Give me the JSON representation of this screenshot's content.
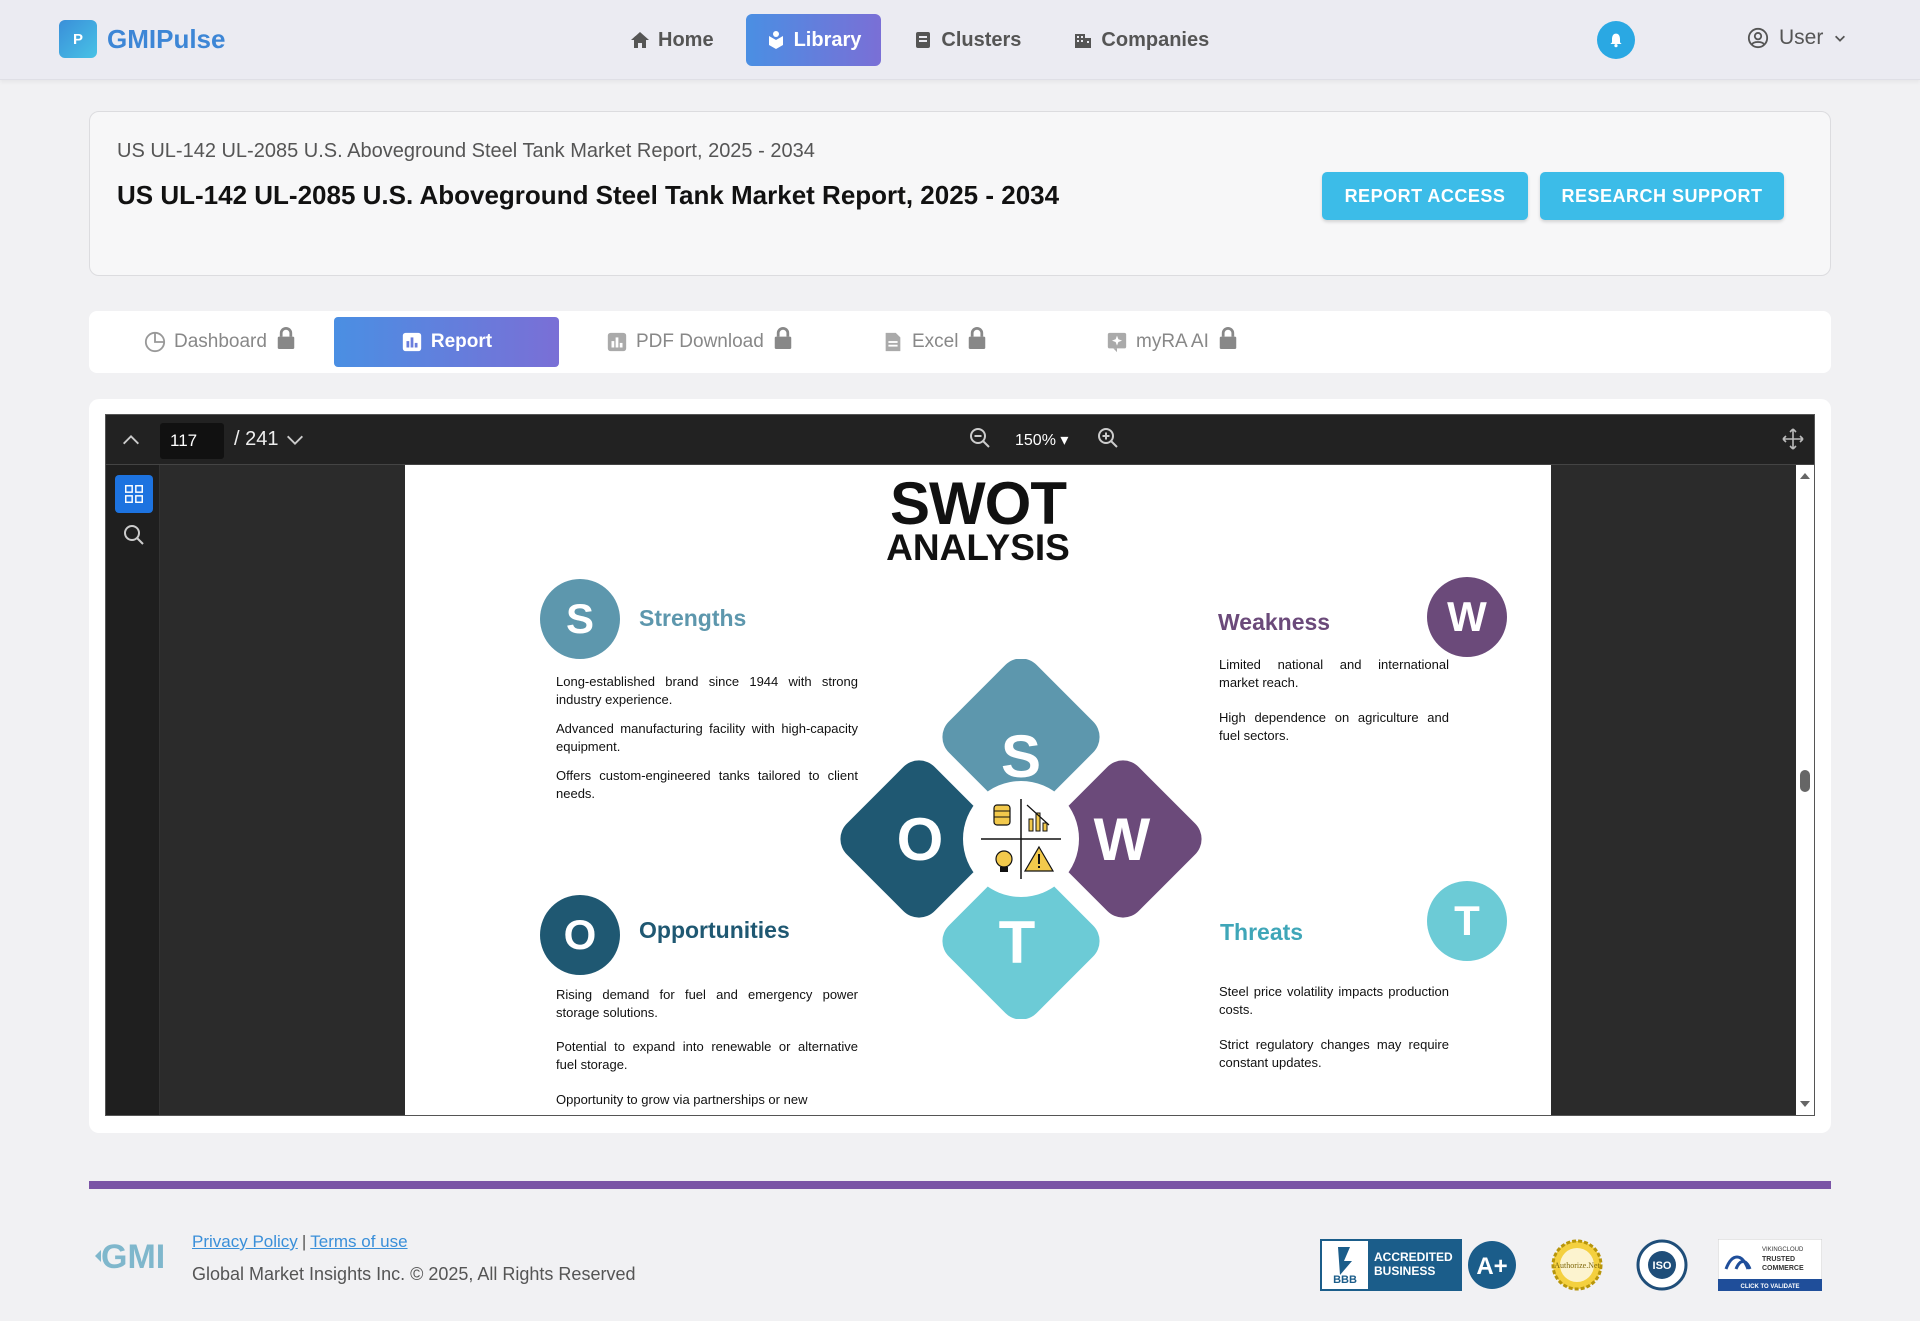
{
  "brand": {
    "name": "GMIPulse",
    "logo_text": "P"
  },
  "nav": {
    "items": [
      {
        "label": "Home",
        "icon": "home-icon"
      },
      {
        "label": "Library",
        "icon": "library-icon"
      },
      {
        "label": "Clusters",
        "icon": "clusters-icon"
      },
      {
        "label": "Companies",
        "icon": "companies-icon"
      }
    ],
    "active": "Library"
  },
  "user": {
    "label": "User"
  },
  "header": {
    "breadcrumb": "US UL-142 UL-2085 U.S. Aboveground Steel Tank Market Report, 2025 - 2034",
    "title": "US UL-142 UL-2085 U.S. Aboveground Steel Tank Market Report, 2025 - 2034",
    "report_access_label": "REPORT ACCESS",
    "research_support_label": "RESEARCH SUPPORT"
  },
  "tabs": {
    "items": [
      {
        "label": "Dashboard",
        "locked": true
      },
      {
        "label": "Report",
        "locked": false
      },
      {
        "label": "PDF Download",
        "locked": true
      },
      {
        "label": "Excel",
        "locked": true
      },
      {
        "label": "myRA AI",
        "locked": true
      }
    ],
    "active": "Report"
  },
  "viewer": {
    "current_page": "117",
    "total_pages": "/ 241",
    "zoom": "150% ▾"
  },
  "swot": {
    "title": "SWOT",
    "subtitle": "ANALYSIS",
    "strengths": {
      "letter": "S",
      "heading": "Strengths",
      "color": "#5d97ad",
      "bullets": [
        "Long-established brand since 1944 with strong industry experience.",
        "Advanced manufacturing facility with high-capacity equipment.",
        "Offers custom-engineered tanks tailored to client needs."
      ]
    },
    "weakness": {
      "letter": "W",
      "heading": "Weakness",
      "color": "#6b4a7a",
      "bullets": [
        "Limited national and international market reach.",
        "High dependence on agriculture and fuel sectors."
      ]
    },
    "opportunities": {
      "letter": "O",
      "heading": "Opportunities",
      "color": "#1f5872",
      "bullets": [
        "Rising demand for fuel and emergency power storage solutions.",
        "Potential to expand into renewable or alternative fuel storage.",
        "Opportunity to grow via partnerships or new"
      ]
    },
    "threats": {
      "letter": "T",
      "heading": "Threats",
      "color": "#6ccbd6",
      "heading_color": "#3fa6b8",
      "bullets": [
        "Steel price volatility impacts production costs.",
        "Strict regulatory changes may require constant updates."
      ]
    }
  },
  "footer": {
    "logo_text": "GMI",
    "privacy_label": "Privacy Policy",
    "separator": "|",
    "terms_label": "Terms of use",
    "copyright": "Global Market Insights Inc. © 2025, All Rights Reserved",
    "badges": {
      "bbb_line1": "ACCREDITED",
      "bbb_line2": "BUSINESS",
      "bbb_grade": "A+",
      "bbb_abbr": "BBB",
      "authorize": "Authorize.Net",
      "iso": "ISO",
      "viking_line1": "VIKINGCLOUD",
      "viking_line2": "TRUSTED",
      "viking_line3": "COMMERCE",
      "viking_cta": "CLICK TO VALIDATE"
    }
  },
  "colors": {
    "accent_blue": "#3cbce8",
    "nav_gradient_start": "#4a8fe3",
    "nav_gradient_end": "#7a6fd6",
    "footer_line": "#7b55a6"
  }
}
